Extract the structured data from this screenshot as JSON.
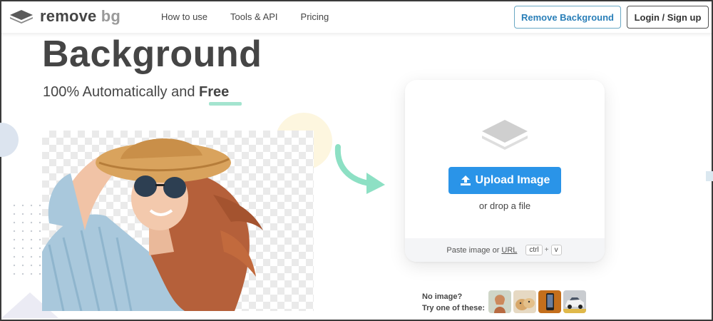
{
  "header": {
    "logo_text_main": "remove",
    "logo_text_accent": "bg",
    "nav": [
      "How to use",
      "Tools & API",
      "Pricing"
    ],
    "remove_background_label": "Remove Background",
    "login_label": "Login / Sign up"
  },
  "hero": {
    "title": "Background",
    "subtitle_prefix": "100% Automatically and ",
    "subtitle_emphasis": "Free"
  },
  "upload": {
    "button_label": "Upload Image",
    "drop_text": "or drop a file",
    "paste_text": "Paste image or",
    "url_link": "URL",
    "shortcut_key1": "ctrl",
    "shortcut_plus": "+",
    "shortcut_key2": "v"
  },
  "samples": {
    "line1": "No image?",
    "line2": "Try one of these:"
  },
  "colors": {
    "primary": "#2a94e8",
    "text": "#454545",
    "accent_underline": "#a4e4cf",
    "arrow": "#8de0c4"
  }
}
